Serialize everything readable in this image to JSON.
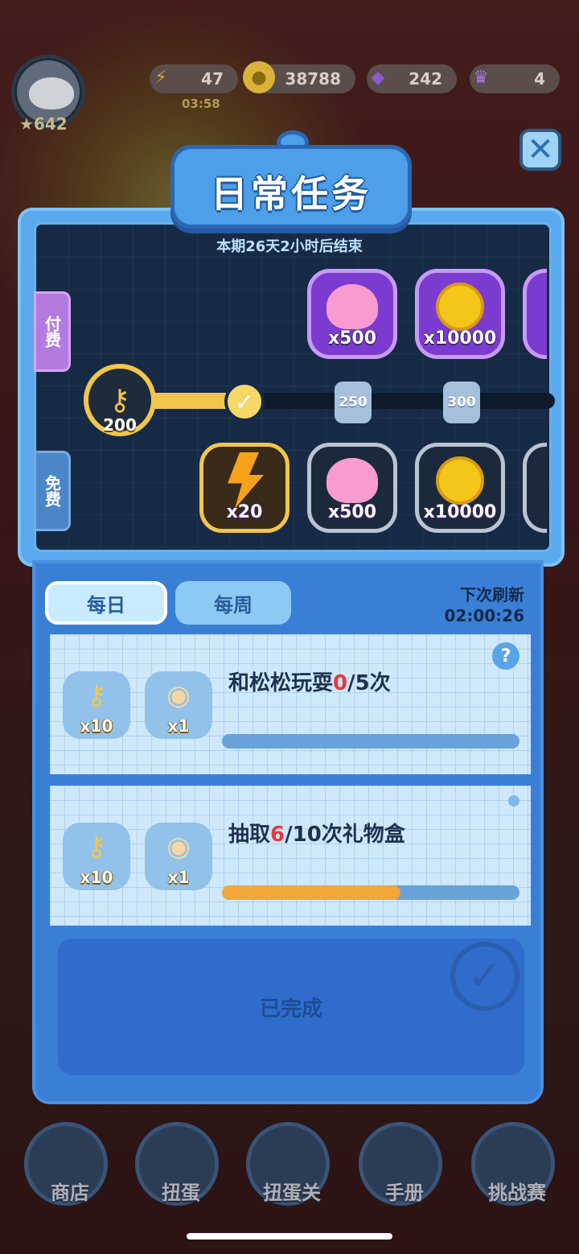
{
  "header": {
    "level": "642",
    "energy": "47",
    "energy_timer": "03:58",
    "coins": "38788",
    "gems": "242",
    "crowns": "4"
  },
  "modal": {
    "title": "日常任务",
    "period": "本期26天2小时后结束",
    "paid_tab": "付费",
    "free_tab": "免费",
    "start_key_value": "200",
    "milestones": [
      "250",
      "300"
    ],
    "paid_rewards": [
      {
        "icon": "heart-icon",
        "qty": "x500"
      },
      {
        "icon": "coin-icon",
        "qty": "x10000"
      }
    ],
    "free_rewards": [
      {
        "icon": "lightning-icon",
        "qty": "x20"
      },
      {
        "icon": "heart-icon",
        "qty": "x500"
      },
      {
        "icon": "coin-icon",
        "qty": "x10000"
      }
    ]
  },
  "tabs": {
    "daily": "每日",
    "weekly": "每周"
  },
  "refresh": {
    "label": "下次刷新",
    "time": "02:00:26"
  },
  "tasks": [
    {
      "title_pre": "和松松玩耍",
      "progress": "0",
      "title_post": "/5次",
      "reward1": "x10",
      "reward2": "x1",
      "progress_fraction": 0
    },
    {
      "title_pre": "抽取",
      "progress": "6",
      "title_post": "/10次礼物盒",
      "reward1": "x10",
      "reward2": "x1",
      "progress_fraction": 0.6
    }
  ],
  "completed_label": "已完成",
  "nav": [
    "商店",
    "扭蛋",
    "扭蛋关",
    "手册",
    "挑战赛"
  ],
  "colors": {
    "accent": "#3a7fd6",
    "highlight": "#e53a3a",
    "progress": "#f1a73a"
  }
}
